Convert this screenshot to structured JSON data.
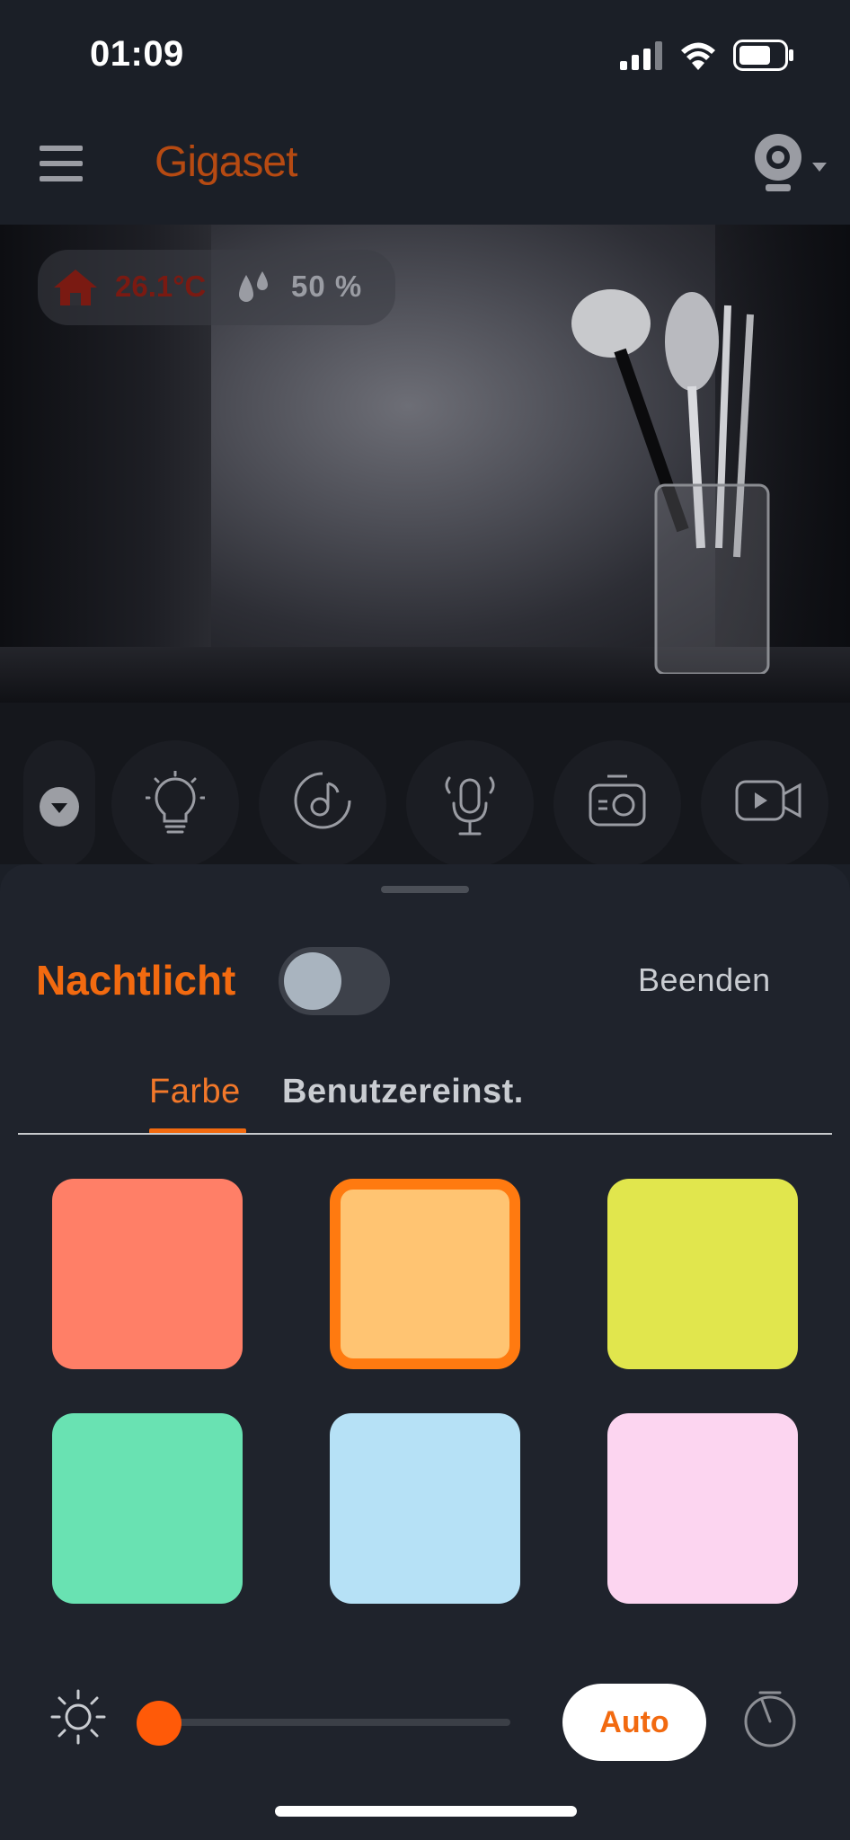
{
  "status_bar": {
    "time": "01:09"
  },
  "header": {
    "logo": "Gigaset",
    "camera_icon": "camera-icon"
  },
  "video": {
    "temperature": "26.1°C",
    "humidity": "50 %"
  },
  "controls": {
    "items": [
      {
        "name": "collapse",
        "icon": "chevron-down-icon"
      },
      {
        "name": "nightlight",
        "icon": "lightbulb-icon"
      },
      {
        "name": "lullaby",
        "icon": "music-icon"
      },
      {
        "name": "intercom",
        "icon": "microphone-icon"
      },
      {
        "name": "snapshot",
        "icon": "camera-icon"
      },
      {
        "name": "record",
        "icon": "video-icon"
      }
    ]
  },
  "sheet": {
    "title": "Nachtlicht",
    "toggle_on": false,
    "end_label": "Beenden",
    "tabs": [
      {
        "label": "Farbe",
        "active": true
      },
      {
        "label": "Benutzereinst.",
        "active": false
      }
    ],
    "swatches": [
      {
        "color": "#ff7f67",
        "selected": false
      },
      {
        "color": "#ffc472",
        "selected": true
      },
      {
        "color": "#e1e64d",
        "selected": false
      },
      {
        "color": "#69e2b2",
        "selected": false
      },
      {
        "color": "#b6e1f6",
        "selected": false
      },
      {
        "color": "#fcd5f0",
        "selected": false
      }
    ],
    "brightness": 0.0,
    "auto_label": "Auto"
  },
  "colors": {
    "accent": "#f26a10",
    "background": "#1f232c"
  }
}
